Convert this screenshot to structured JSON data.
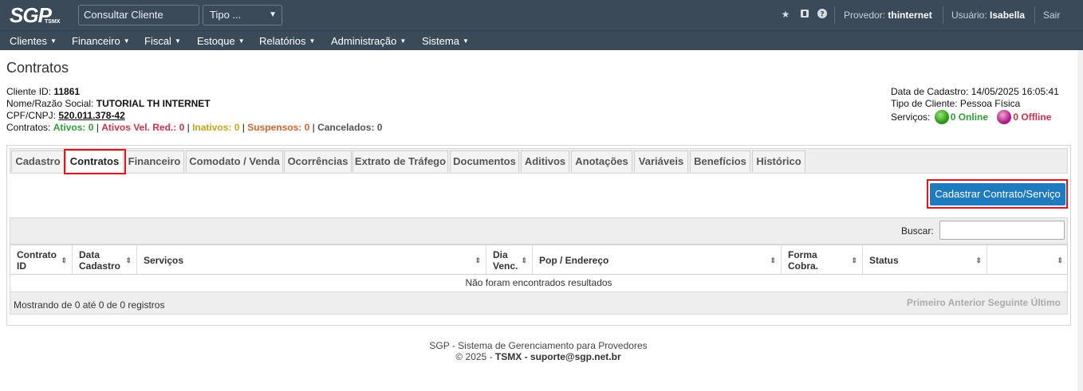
{
  "topbar": {
    "logo_main": "SGP",
    "logo_sub": "TSMX",
    "search_placeholder": "Consultar Cliente",
    "tipo_select": "Tipo ...",
    "icons": [
      "star-icon",
      "bookmark-icon",
      "help-icon"
    ],
    "provedor_label": "Provedor:",
    "provedor_value": "thinternet",
    "usuario_label": "Usuário:",
    "usuario_value": "Isabella",
    "sair": "Sair"
  },
  "menu": [
    "Clientes",
    "Financeiro",
    "Fiscal",
    "Estoque",
    "Relatórios",
    "Administração",
    "Sistema"
  ],
  "page": {
    "title": "Contratos"
  },
  "client": {
    "id_label": "Cliente ID:",
    "id_value": "11861",
    "nome_label": "Nome/Razão Social:",
    "nome_value": "TUTORIAL TH INTERNET",
    "cpf_label": "CPF/CNPJ:",
    "cpf_value": "520.011.378-42",
    "contratos_label": "Contratos:",
    "ativos": "Ativos: 0",
    "ativos_red": "Ativos Vel. Red.: 0",
    "inativos": "Inativos: 0",
    "suspensos": "Suspensos: 0",
    "cancelados": "Cancelados: 0",
    "sep": "|",
    "data_cadastro": "Data de Cadastro: 14/05/2025 16:05:41",
    "tipo_cliente": "Tipo de Cliente: Pessoa Física",
    "servicos_label": "Serviços:",
    "online": "0 Online",
    "offline": "0 Offline"
  },
  "tabs": [
    "Cadastro",
    "Contratos",
    "Financeiro",
    "Comodato / Venda",
    "Ocorrências",
    "Extrato de Tráfego",
    "Documentos",
    "Aditivos",
    "Anotações",
    "Variáveis",
    "Benefícios",
    "Histórico"
  ],
  "active_tab": "Contratos",
  "cadastrar_button": "Cadastrar Contrato/Serviço",
  "table": {
    "buscar_label": "Buscar:",
    "columns": [
      {
        "line1": "Contrato",
        "line2": "ID"
      },
      {
        "line1": "Data",
        "line2": "Cadastro"
      },
      {
        "line1": "Serviços",
        "line2": ""
      },
      {
        "line1": "Dia",
        "line2": "Venc."
      },
      {
        "line1": "Pop / Endereço",
        "line2": ""
      },
      {
        "line1": "Forma",
        "line2": "Cobra."
      },
      {
        "line1": "Status",
        "line2": ""
      },
      {
        "line1": "",
        "line2": ""
      }
    ],
    "empty_message": "Não foram encontrados resultados",
    "mostrando": "Mostrando de 0 até 0 de 0 registros",
    "pager": [
      "Primeiro",
      "Anterior",
      "Seguinte",
      "Último"
    ]
  },
  "footer": {
    "line1": "SGP - Sistema de Gerenciamento para Provedores",
    "line2_prefix": "© 2025 - ",
    "line2_company": "TSMX",
    "line2_sep": " - ",
    "line2_email": "suporte@sgp.net.br"
  },
  "colors": {
    "topbar": "#3a4a58",
    "primary_button": "#1f7bc0",
    "highlight": "#e0161b",
    "online": "#2e9e36",
    "offline": "#d0324a"
  }
}
